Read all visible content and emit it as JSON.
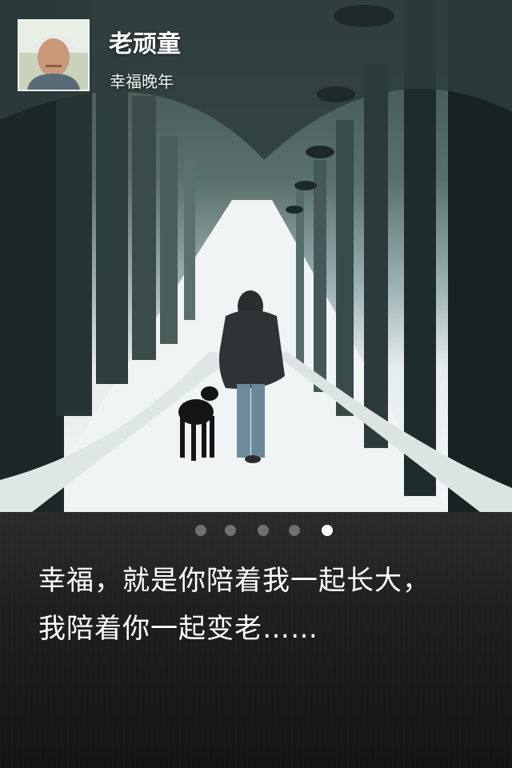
{
  "profile": {
    "name": "老顽童",
    "tagline": "幸福晚年",
    "avatar_icon": "person-avatar-icon"
  },
  "carousel": {
    "page_count": 5,
    "current_page": 5
  },
  "caption": {
    "line1": "幸福，就是你陪着我一起长大，",
    "line2": "我陪着你一起变老……"
  },
  "colors": {
    "panel_background": "#1e1e1e",
    "dot_inactive": "#6f6f6f",
    "dot_active": "#ffffff"
  }
}
